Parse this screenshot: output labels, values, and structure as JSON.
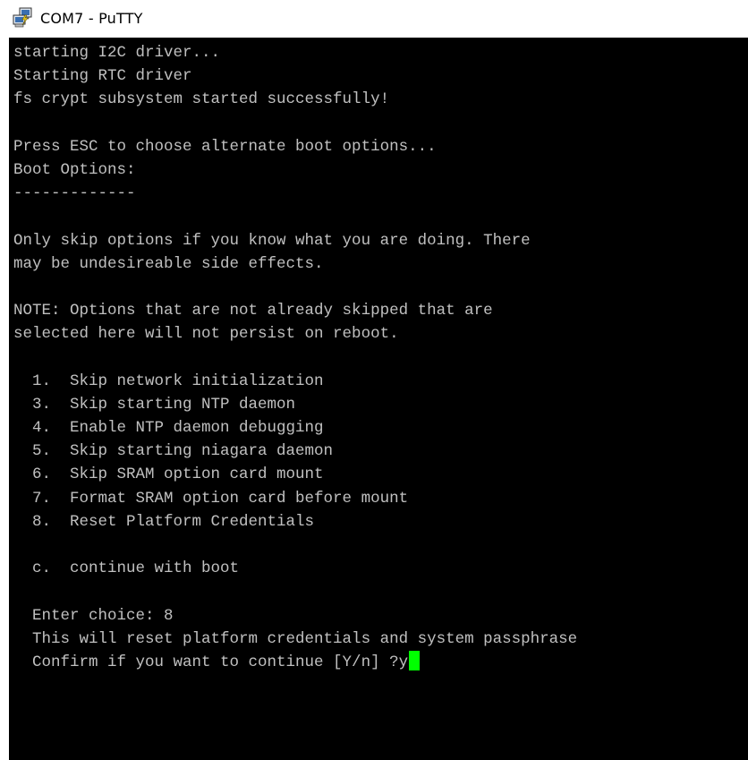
{
  "window": {
    "title": "COM7 - PuTTY",
    "icon": "putty-computers-icon"
  },
  "terminal": {
    "colors": {
      "background": "#000000",
      "foreground": "#c0c0c0",
      "cursor": "#00ff00"
    },
    "lines": [
      "starting I2C driver...",
      "Starting RTC driver",
      "fs crypt subsystem started successfully!",
      "",
      "Press ESC to choose alternate boot options...",
      "Boot Options:",
      "-------------",
      "",
      "Only skip options if you know what you are doing. There",
      "may be undesireable side effects.",
      "",
      "NOTE: Options that are not already skipped that are",
      "selected here will not persist on reboot.",
      "",
      "  1.  Skip network initialization",
      "  3.  Skip starting NTP daemon",
      "  4.  Enable NTP daemon debugging",
      "  5.  Skip starting niagara daemon",
      "  6.  Skip SRAM option card mount",
      "  7.  Format SRAM option card before mount",
      "  8.  Reset Platform Credentials",
      "",
      "  c.  continue with boot",
      "",
      "  Enter choice: 8",
      "  This will reset platform credentials and system passphrase",
      "  Confirm if you want to continue [Y/n] ?y"
    ],
    "cursor_line": 26
  }
}
